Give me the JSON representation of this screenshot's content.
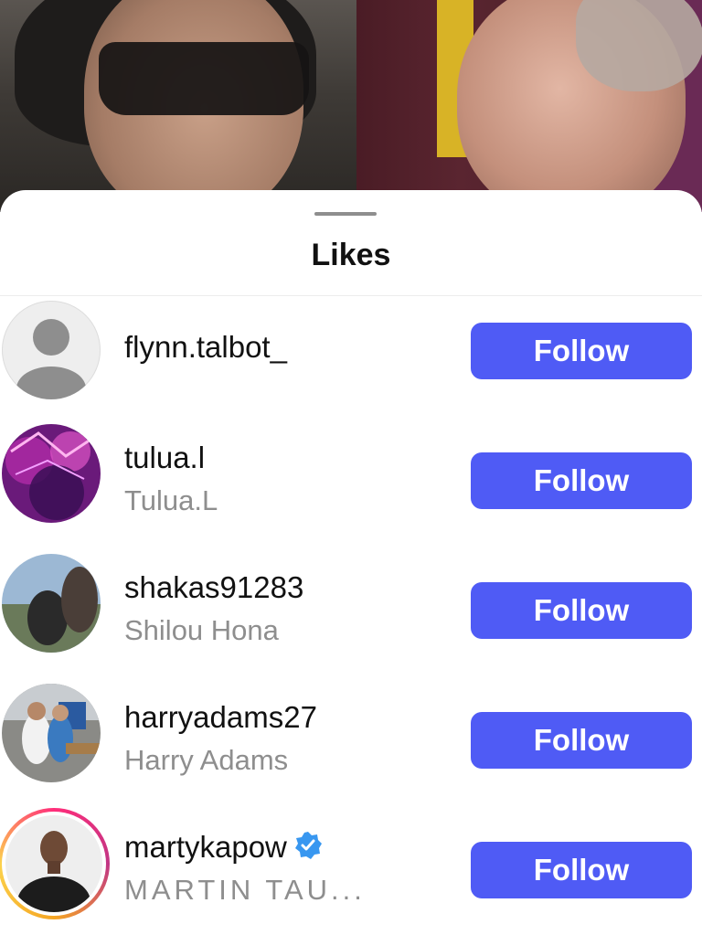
{
  "sheet": {
    "title": "Likes"
  },
  "likes": [
    {
      "username": "flynn.talbot_",
      "full_name": "",
      "button": "Follow",
      "avatar": "default-avatar-icon"
    },
    {
      "username": "tulua.l",
      "full_name": "Tulua.L",
      "button": "Follow",
      "avatar": "purple-stage-photo"
    },
    {
      "username": "shakas91283",
      "full_name": "Shilou Hona",
      "button": "Follow",
      "avatar": "outdoor-photo"
    },
    {
      "username": "harryadams27",
      "full_name": "Harry Adams",
      "button": "Follow",
      "avatar": "two-people-photo"
    },
    {
      "username": "martykapow",
      "full_name": "MARTIN TAU...",
      "button": "Follow",
      "verified": true,
      "avatar": "portrait-photo-with-story-ring"
    }
  ],
  "colors": {
    "follow_button": "#4f5bf5",
    "verified_badge": "#3897f0",
    "secondary_text": "#8e8e8e"
  }
}
